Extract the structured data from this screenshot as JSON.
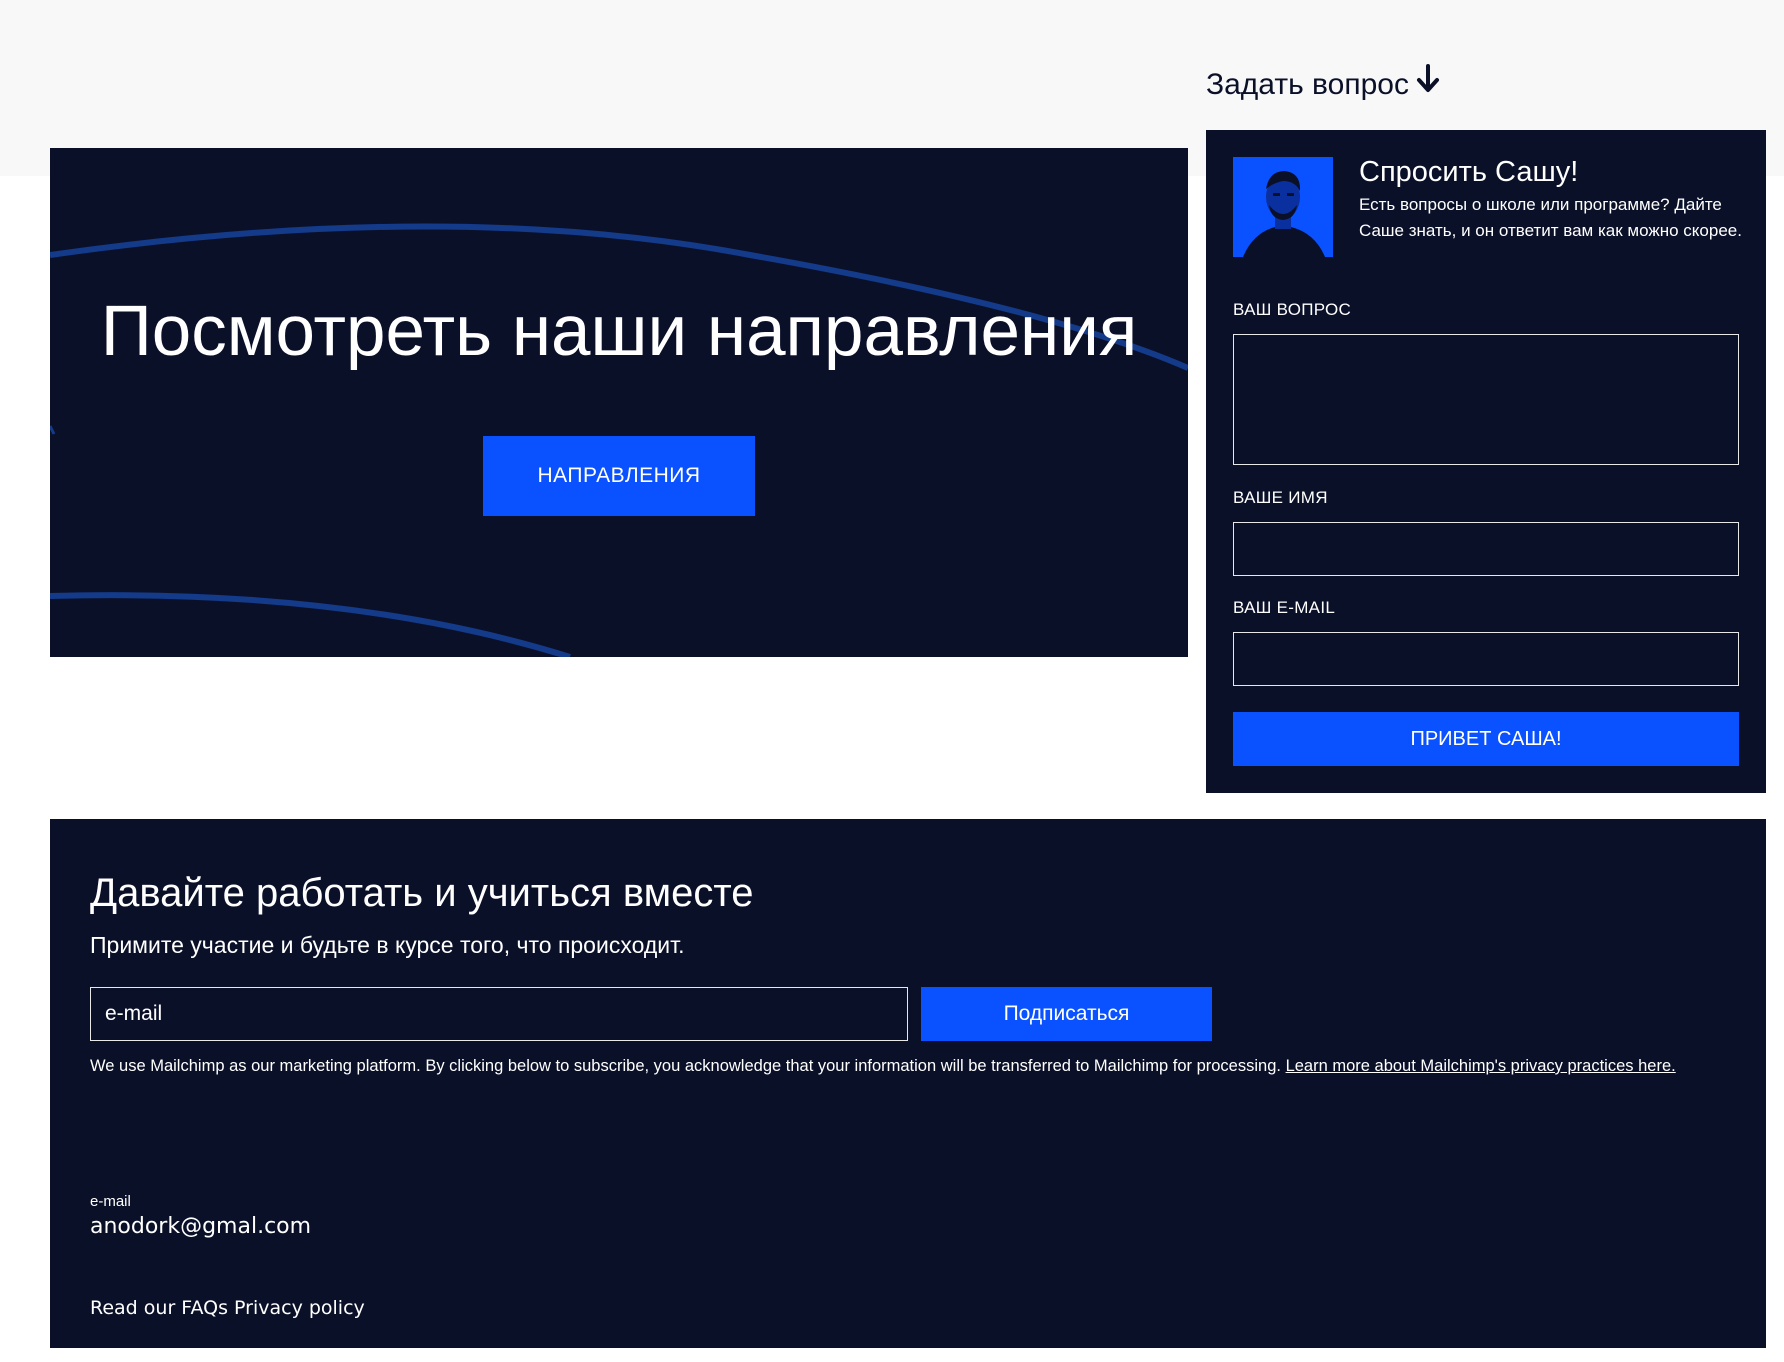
{
  "hero": {
    "title": "Посмотреть наши направления",
    "button_label": "НАПРАВЛЕНИЯ"
  },
  "ask": {
    "heading": "Задать вопрос",
    "heading_icon": "arrow-down-icon",
    "title": "Спросить Сашу!",
    "description": "Есть вопросы о школе или программе? Дайте Саше знать, и он ответит вам как можно скорее.",
    "question_label": "ВАШ ВОПРОС",
    "question_value": "",
    "name_label": "ВАШЕ ИМЯ",
    "name_value": "",
    "email_label": "ВАШ E-MAIL",
    "email_value": "",
    "submit_label": "ПРИВЕТ САША!"
  },
  "footer": {
    "title": "Давайте работать и учиться вместе",
    "subtitle": "Примите участие и будьте в курсе того, что происходит.",
    "email_placeholder": "e-mail",
    "subscribe_label": "Подписаться",
    "legal_text": "We use Mailchimp as our marketing platform. By clicking below to subscribe, you acknowledge that your information will be transferred to Mailchimp for processing. ",
    "legal_link": "Learn more about Mailchimp's privacy practices here.",
    "contact_label": "e-mail",
    "contact_value": "anodork@gmal.com",
    "links": [
      "Read our FAQs",
      "Privacy policy"
    ]
  },
  "colors": {
    "navy": "#0b1029",
    "accent_blue": "#0a52ff",
    "band_gray": "#f8f8f8"
  }
}
